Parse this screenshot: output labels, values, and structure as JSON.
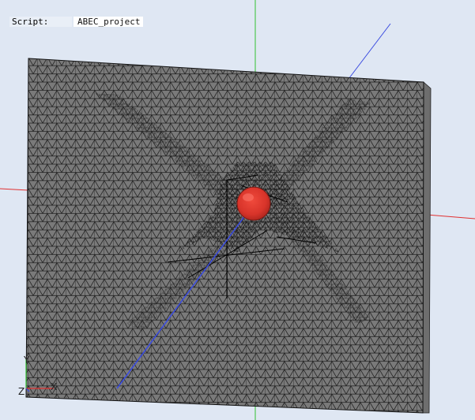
{
  "script": {
    "label": "Script:",
    "value": "ABEC_project"
  },
  "triad": {
    "y_label": "Y",
    "z_label": "Z",
    "x_label": "X"
  },
  "colors": {
    "background": "#dfe7f3",
    "mesh_fill": "#777777",
    "mesh_lines": "#222222",
    "source_sphere": "#d8342a",
    "axis_x": "#e03030",
    "axis_y": "#30c030",
    "axis_z": "#3a4be0"
  },
  "icons": {
    "triad": "xyz-axis-triad-icon",
    "source": "sound-source-sphere-icon"
  }
}
